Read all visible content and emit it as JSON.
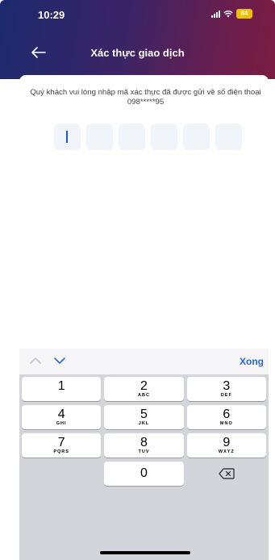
{
  "status_bar": {
    "time": "10:29",
    "battery": "84"
  },
  "nav": {
    "title": "Xác thực giao dịch"
  },
  "main": {
    "instruction": "Quý khách vui lòng nhập mã xác thực đã được gửi về số điện thoại 098*****95",
    "otp_length": 6,
    "otp_value": ""
  },
  "keyboard": {
    "done_label": "Xong",
    "rows": [
      [
        {
          "num": "1",
          "letters": ""
        },
        {
          "num": "2",
          "letters": "ABC"
        },
        {
          "num": "3",
          "letters": "DEF"
        }
      ],
      [
        {
          "num": "4",
          "letters": "GHI"
        },
        {
          "num": "5",
          "letters": "JKL"
        },
        {
          "num": "6",
          "letters": "MNO"
        }
      ],
      [
        {
          "num": "7",
          "letters": "PQRS"
        },
        {
          "num": "8",
          "letters": "TUV"
        },
        {
          "num": "9",
          "letters": "WXYZ"
        }
      ],
      [
        {
          "num": "",
          "letters": ""
        },
        {
          "num": "0",
          "letters": ""
        },
        {
          "num": "",
          "letters": ""
        }
      ]
    ]
  },
  "icons": {
    "back": "arrow-left-icon",
    "delete": "backspace-icon",
    "prev": "chevron-up-icon",
    "next": "chevron-down-icon"
  },
  "colors": {
    "header_start": "#1d2a6e",
    "header_end": "#7a1c40",
    "accent": "#2a66d8",
    "otp_box": "#f1f4f8",
    "battery": "#f0c000"
  }
}
